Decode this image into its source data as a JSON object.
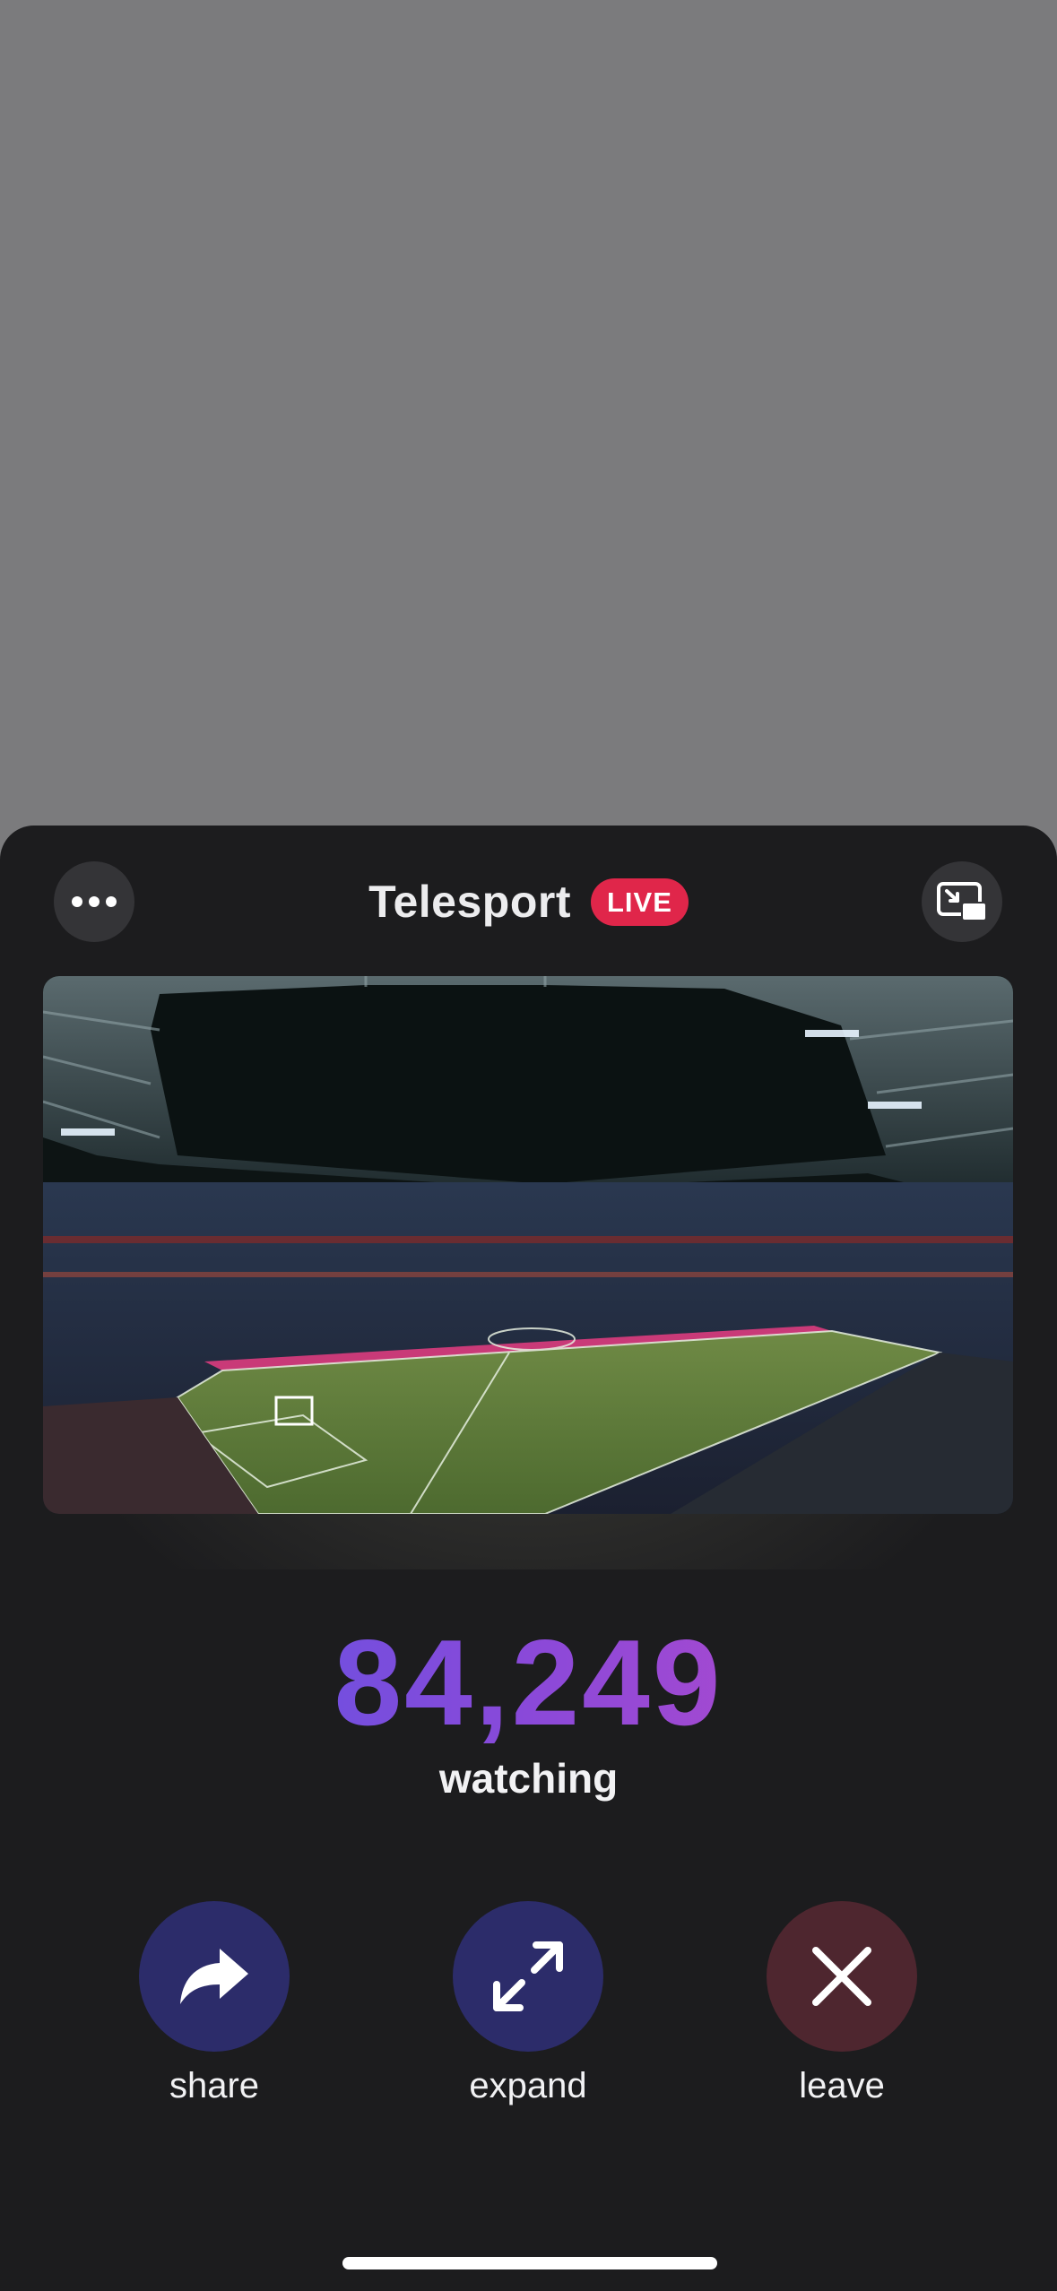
{
  "header": {
    "title": "Telesport",
    "live_badge": "LIVE",
    "more_icon": "ellipsis-icon",
    "pip_icon": "picture-in-picture-exit-icon"
  },
  "video": {
    "description_icon": "stadium-video-frame"
  },
  "stats": {
    "viewer_count": "84,249",
    "viewer_label": "watching"
  },
  "actions": [
    {
      "label": "share",
      "icon": "share-arrow-icon",
      "color": "#2c2c6a"
    },
    {
      "label": "expand",
      "icon": "expand-arrows-icon",
      "color": "#2c2c6a"
    },
    {
      "label": "leave",
      "icon": "close-icon",
      "color": "#4e262f"
    }
  ],
  "colors": {
    "live": "#e0264a",
    "gradient_start": "#4f58e6",
    "gradient_end": "#c94ac4",
    "sheet_bg": "#1c1c1e",
    "backdrop": "#7b7b7d"
  }
}
